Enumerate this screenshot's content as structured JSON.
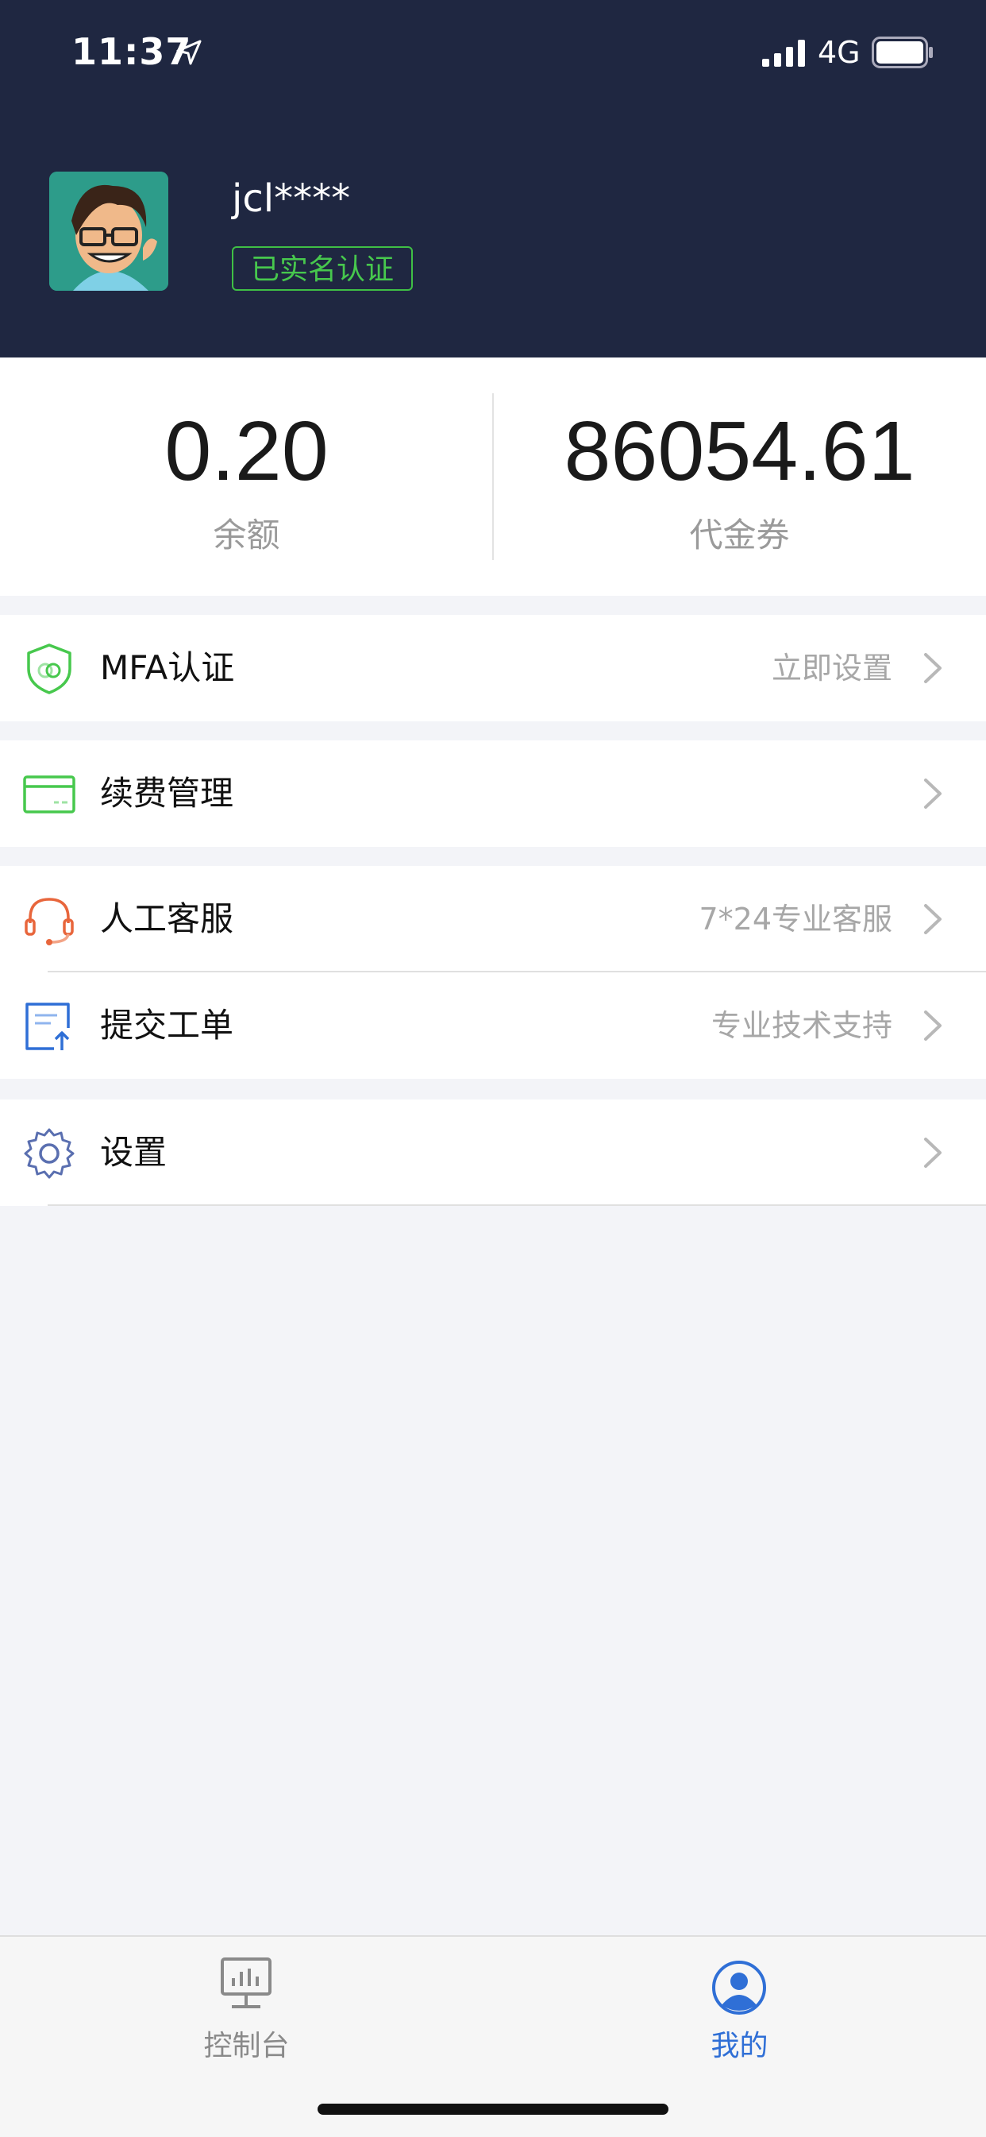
{
  "status_bar": {
    "time": "11:37",
    "network": "4G"
  },
  "profile": {
    "username": "jcl****",
    "verify_badge": "已实名认证"
  },
  "stats": [
    {
      "value": "0.20",
      "label": "余额"
    },
    {
      "value": "86054.61",
      "label": "代金券"
    }
  ],
  "menu": {
    "mfa": {
      "label": "MFA认证",
      "right": "立即设置",
      "icon": "shield-icon"
    },
    "renew": {
      "label": "续费管理",
      "icon": "card-icon"
    },
    "service": {
      "label": "人工客服",
      "right": "7*24专业客服",
      "icon": "headset-icon"
    },
    "ticket": {
      "label": "提交工单",
      "right": "专业技术支持",
      "icon": "ticket-icon"
    },
    "settings": {
      "label": "设置",
      "icon": "gear-icon"
    }
  },
  "tabbar": {
    "console": {
      "label": "控制台",
      "icon": "monitor-icon"
    },
    "mine": {
      "label": "我的",
      "icon": "user-icon"
    }
  },
  "colors": {
    "header_bg": "#1f2741",
    "accent_green": "#47c84d",
    "accent_blue": "#2f6fd6",
    "accent_orange": "#e8663c",
    "page_bg": "#f3f4f8"
  }
}
